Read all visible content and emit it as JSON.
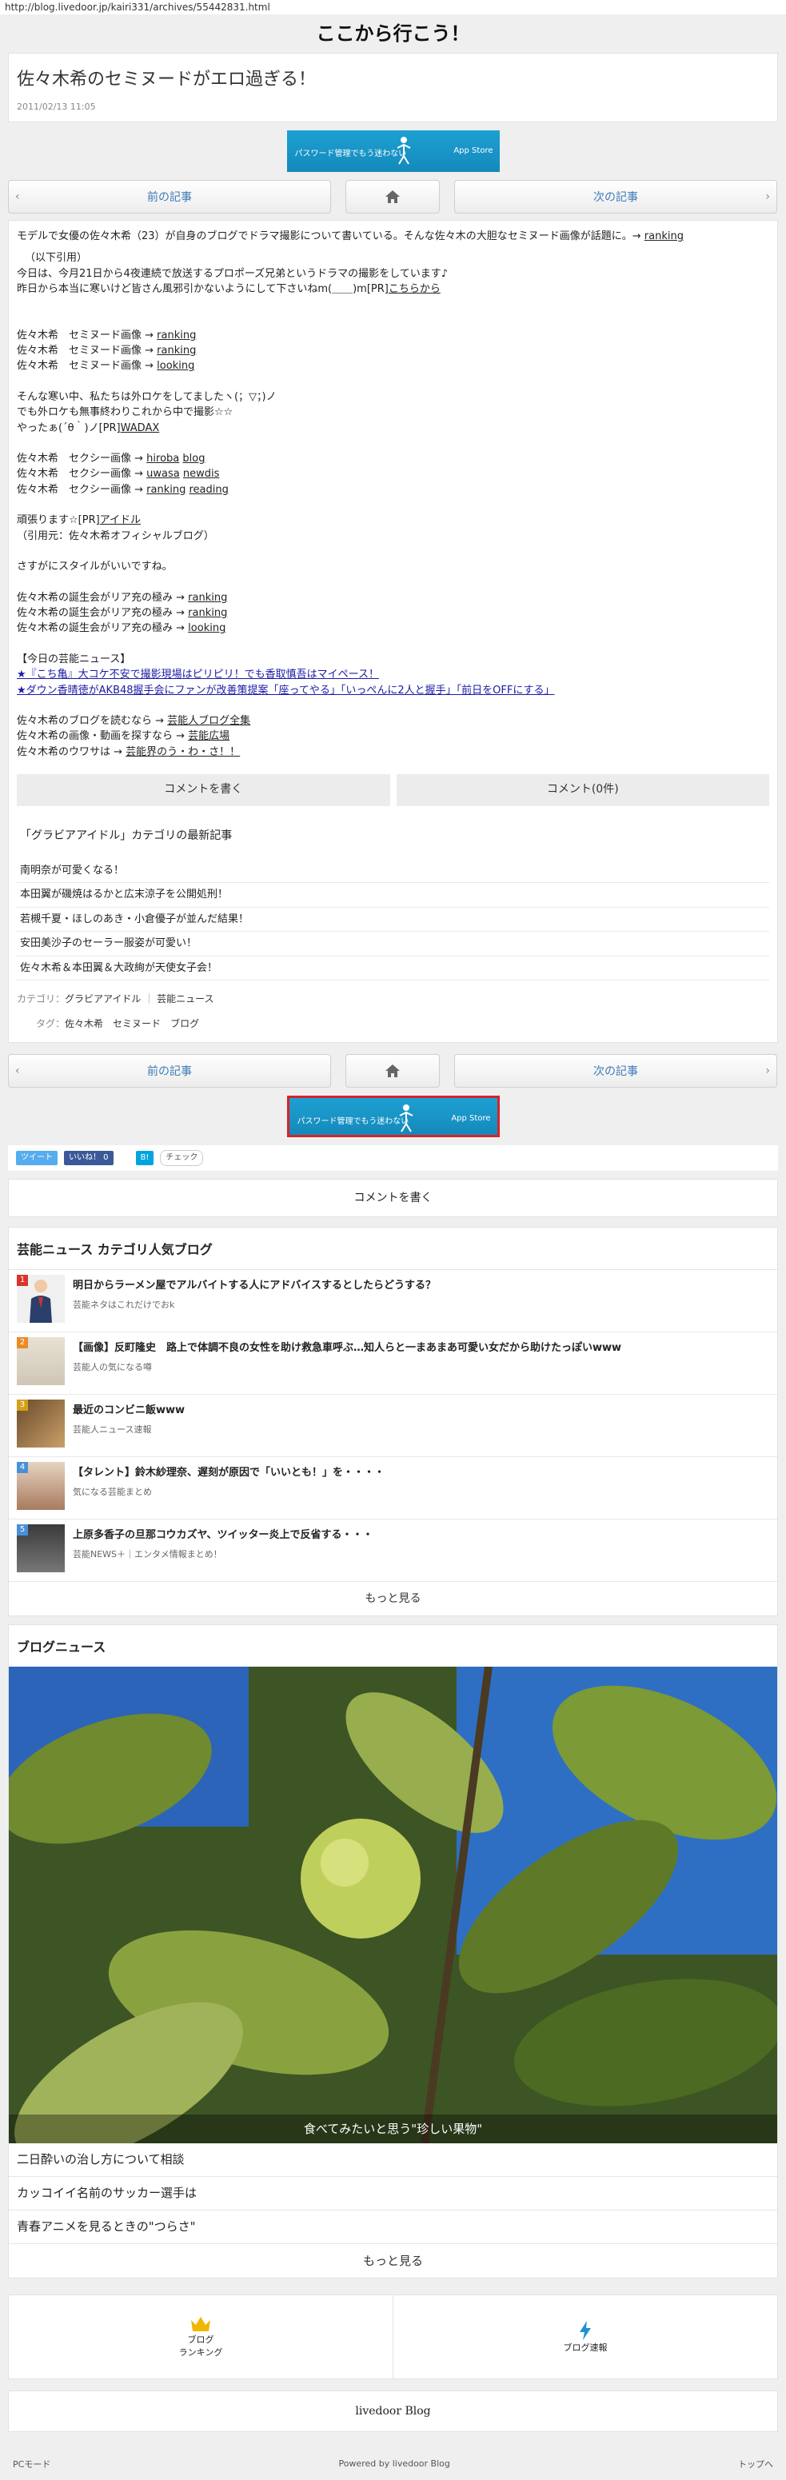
{
  "url": "http://blog.livedoor.jp/kairi331/archives/55442831.html",
  "site_title": "ここから行こう！",
  "post": {
    "title": "佐々木希のセミヌードがエロ過ぎる！",
    "date": "2011/02/13 11:05"
  },
  "banner": {
    "text": "パスワード管理でもう迷わない",
    "store": "App Store"
  },
  "nav": {
    "prev": "前の記事",
    "next": "次の記事",
    "home_icon": "home-icon"
  },
  "article": {
    "intro": "モデルで女優の佐々木希（23）が自身のブログでドラマ撮影について書いている。そんな佐々木の大胆なセミヌード画像が話題に。→ ",
    "intro_link": "ranking",
    "quote_head": "（以下引用）",
    "quote_line1": "今日は、今月21日から4夜連続で放送するプロポーズ兄弟というドラマの撮影をしています♪",
    "quote_line2_pre": "昨日から本当に寒いけど皆さん風邪引かないようにして下さいねm(＿＿)m[PR]",
    "quote_line2_link": "こちらから",
    "links_a": [
      {
        "pre": "佐々木希　セミヌード画像 → ",
        "link": "ranking"
      },
      {
        "pre": "佐々木希　セミヌード画像 → ",
        "link": "ranking"
      },
      {
        "pre": "佐々木希　セミヌード画像 → ",
        "link": "looking"
      }
    ],
    "mid_line1": "そんな寒い中、私たちは外ロケをしてましたヽ(；▽；)ノ",
    "mid_line2": "でも外ロケも無事終わりこれから中で撮影☆☆",
    "mid_line3_pre": "やったぁ(´θ｀)ノ[PR]",
    "mid_line3_link": "WADAX",
    "links_b": [
      {
        "pre": "佐々木希　セクシー画像 → ",
        "link": "hiroba",
        "link2": "blog"
      },
      {
        "pre": "佐々木希　セクシー画像 → ",
        "link": "uwasa",
        "link2": "newdis"
      },
      {
        "pre": "佐々木希　セクシー画像 → ",
        "link": "ranking",
        "link2": "reading"
      }
    ],
    "ganbari_pre": "頑張ります☆[PR]",
    "ganbari_link": "アイドル",
    "source": "（引用元：佐々木希オフィシャルブログ）",
    "style_line": "さすがにスタイルがいいですね。",
    "links_c": [
      {
        "pre": "佐々木希の誕生会がリア充の極み → ",
        "link": "ranking"
      },
      {
        "pre": "佐々木希の誕生会がリア充の極み → ",
        "link": "ranking"
      },
      {
        "pre": "佐々木希の誕生会がリア充の極み → ",
        "link": "looking"
      }
    ],
    "today_head": "【今日の芸能ニュース】",
    "today_1": "★『こち亀』大コケ不安で撮影現場はピリピリ！でも香取慎吾はマイペース！",
    "today_2": "★ダウン香晴徳がAKB48握手会にファンが改善策提案「座ってやる」「いっぺんに2人と握手」「前日をOFFにする」",
    "tail": [
      {
        "pre": "佐々木希のブログを読むなら → ",
        "link": "芸能人ブログ全集"
      },
      {
        "pre": "佐々木希の画像・動画を探すなら → ",
        "link": "芸能広場"
      },
      {
        "pre": "佐々木希のウワサは → ",
        "link": "芸能界のう・わ・さ！！"
      }
    ]
  },
  "actions": {
    "write": "コメントを書く",
    "count": "コメント(0件)"
  },
  "related": {
    "heading": "「グラビアアイドル」カテゴリの最新記事",
    "items": [
      "南明奈が可愛くなる！",
      "本田翼が磯焼はるかと広末涼子を公開処刑！",
      "若槻千夏・ほしのあき・小倉優子が並んだ結果！",
      "安田美沙子のセーラー服姿が可愛い！",
      "佐々木希＆本田翼＆大政絢が天使女子会！"
    ]
  },
  "meta": {
    "cat_label": "カテゴリ：",
    "cat1": "グラビアアイドル",
    "cat2": "芸能ニュース",
    "tag_label": "タグ：",
    "tags": [
      "佐々木希",
      "セミヌード",
      "ブログ"
    ]
  },
  "social": {
    "tweet": "ツイート",
    "like": "いいね！ 0",
    "hatena": "B!",
    "check": "チェック"
  },
  "comment_write": "コメントを書く",
  "ranking": {
    "heading": "芸能ニュース カテゴリ人気ブログ",
    "items": [
      {
        "num": "1",
        "title": "明日からラーメン屋でアルバイトする人にアドバイスするとしたらどうする？",
        "sub": "芸能ネタはこれだけでおk"
      },
      {
        "num": "2",
        "title": "【画像】反町隆史　路上で体調不良の女性を助け救急車呼ぶ…知人らと一まあまあ可愛い女だから助けたっぽいwww",
        "sub": "芸能人の気になる噂"
      },
      {
        "num": "3",
        "title": "最近のコンビニ飯www",
        "sub": "芸能人ニュース速報"
      },
      {
        "num": "4",
        "title": "【タレント】鈴木紗理奈、遅刻が原因で「いいとも！」を・・・・",
        "sub": "気になる芸能まとめ"
      },
      {
        "num": "5",
        "title": "上原多香子の旦那コウカズヤ、ツイッター炎上で反省する・・・",
        "sub": "芸能NEWS＋｜エンタメ情報まとめ！"
      }
    ],
    "more": "もっと見る"
  },
  "blognews": {
    "heading": "ブログニュース",
    "caption": "食べてみたいと思う\"珍しい果物\"",
    "items": [
      "二日酔いの治し方について相談",
      "カッコイイ名前のサッカー選手は",
      "青春アニメを見るときの\"つらさ\""
    ],
    "more": "もっと見る"
  },
  "footer": {
    "ranking_label_1": "ブログ",
    "ranking_label_2": "ランキング",
    "speed_label": "ブログ速報",
    "logo": "livedoor Blog",
    "pc_mode": "PCモード",
    "powered": "Powered by livedoor Blog",
    "top": "トップへ"
  },
  "colors": {
    "link_blue": "#3d7ab8",
    "twitter": "#55acee",
    "facebook": "#3b5998",
    "hatena": "#00a4de",
    "crown": "#f2b600",
    "bolt": "#1e90d2"
  }
}
